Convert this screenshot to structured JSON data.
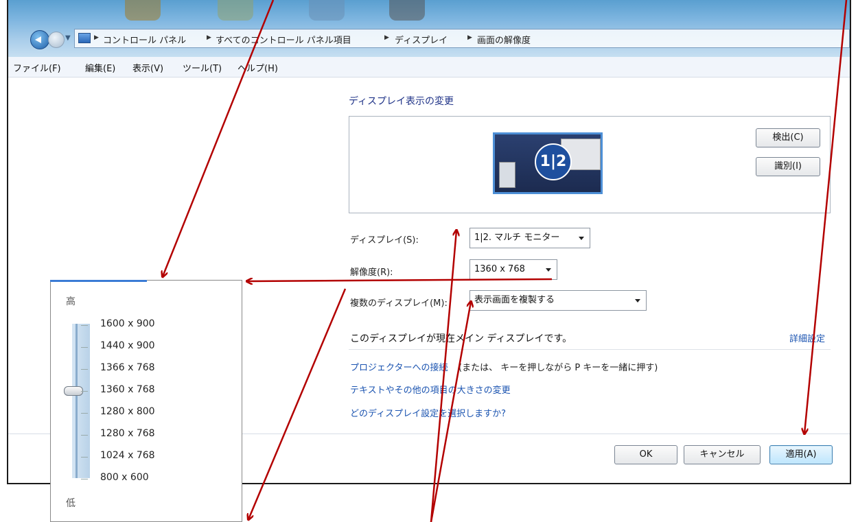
{
  "breadcrumb": [
    "コントロール パネル",
    "すべてのコントロール パネル項目",
    "ディスプレイ",
    "画面の解像度"
  ],
  "menu": [
    "ファイル(F)",
    "編集(E)",
    "表示(V)",
    "ツール(T)",
    "ヘルプ(H)"
  ],
  "panel": {
    "title": "ディスプレイ表示の変更",
    "monitor_label": "1|2",
    "detect_button": "検出(C)",
    "identify_button": "識別(I)"
  },
  "settings": {
    "display_label": "ディスプレイ(S):",
    "display_value": "1|2. マルチ モニター",
    "resolution_label": "解像度(R):",
    "resolution_value": "1360 x 768",
    "multi_label": "複数のディスプレイ(M):",
    "multi_value": "表示画面を複製する",
    "main_display_text": "このディスプレイが現在メイン ディスプレイです。",
    "advanced_link": "詳細設定"
  },
  "links": {
    "projector": "プロジェクターへの接続",
    "projector_suffix": "(または、 キーを押しながら P キーを一緒に押す)",
    "text_size": "テキストやその他の項目の大きさの変更",
    "which_settings": "どのディスプレイ設定を選択しますか?"
  },
  "buttons": {
    "ok": "OK",
    "cancel": "キャンセル",
    "apply": "適用(A)"
  },
  "popup": {
    "high": "高",
    "low": "低",
    "resolutions": [
      "1600 x 900",
      "1440 x 900",
      "1366 x 768",
      "1360 x 768",
      "1280 x 800",
      "1280 x 768",
      "1024 x 768",
      "800 x 600"
    ],
    "selected": "1360 x 768"
  },
  "colors": {
    "annotation_arrow": "#b30000",
    "link": "#1a53b0",
    "title": "#1e3287"
  }
}
